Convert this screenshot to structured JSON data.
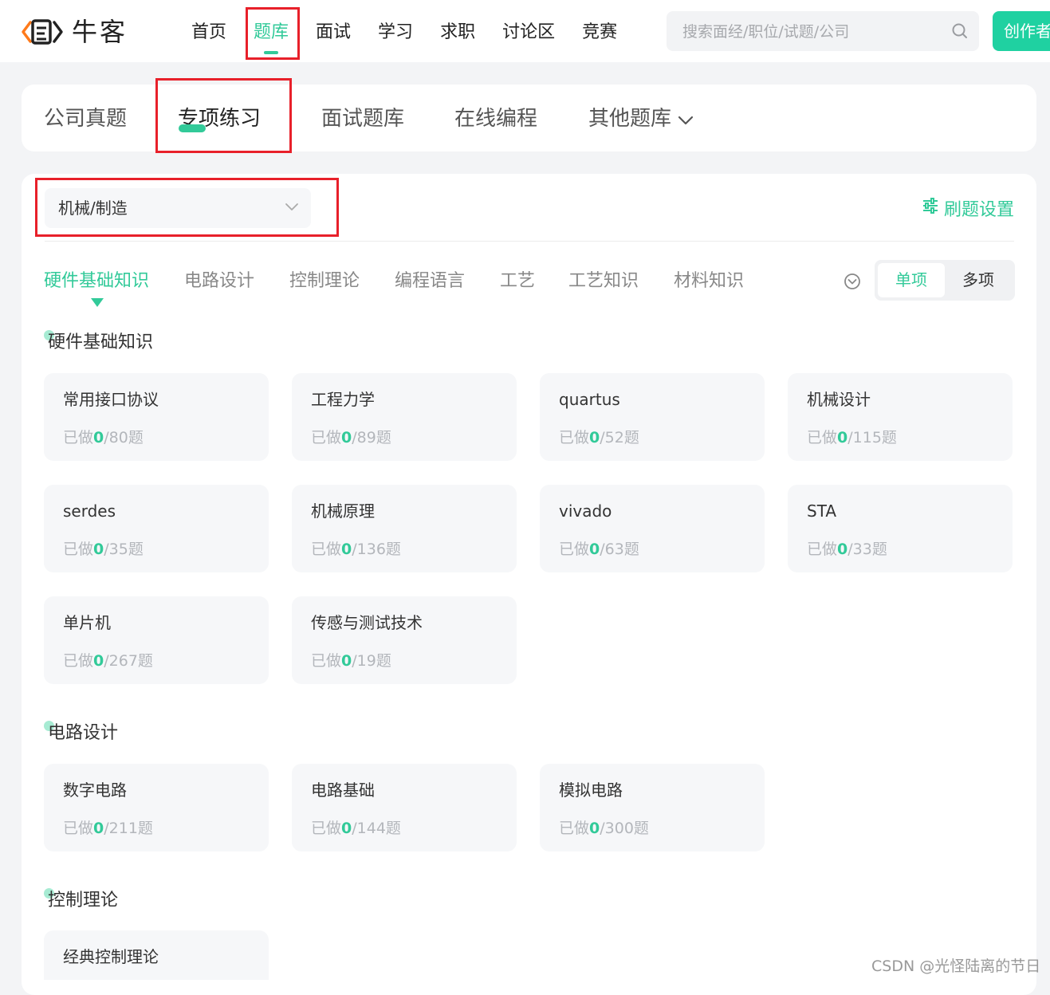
{
  "header": {
    "logo_text": "牛客",
    "nav": [
      "首页",
      "题库",
      "面试",
      "学习",
      "求职",
      "讨论区",
      "竞赛"
    ],
    "active_nav": 1,
    "search_placeholder": "搜索面经/职位/试题/公司",
    "create_button": "创作者"
  },
  "tabs": {
    "items": [
      "公司真题",
      "专项练习",
      "面试题库",
      "在线编程",
      "其他题库"
    ],
    "active": 1
  },
  "filter": {
    "selected_field": "机械/制造",
    "settings_label": "刷题设置",
    "categories": [
      "硬件基础知识",
      "电路设计",
      "控制理论",
      "编程语言",
      "工艺",
      "工艺知识",
      "材料知识"
    ],
    "active_category": 0,
    "mode_single": "单项",
    "mode_multi": "多项",
    "active_mode": "单项"
  },
  "progress_text": {
    "done_prefix": "已做",
    "suffix": "题"
  },
  "sections": [
    {
      "title": "硬件基础知识",
      "items": [
        {
          "name": "常用接口协议",
          "done": "0",
          "total": "/80"
        },
        {
          "name": "工程力学",
          "done": "0",
          "total": "/89"
        },
        {
          "name": "quartus",
          "done": "0",
          "total": "/52"
        },
        {
          "name": "机械设计",
          "done": "0",
          "total": "/115"
        },
        {
          "name": "serdes",
          "done": "0",
          "total": "/35"
        },
        {
          "name": "机械原理",
          "done": "0",
          "total": "/136"
        },
        {
          "name": "vivado",
          "done": "0",
          "total": "/63"
        },
        {
          "name": "STA",
          "done": "0",
          "total": "/33"
        },
        {
          "name": "单片机",
          "done": "0",
          "total": "/267"
        },
        {
          "name": "传感与测试技术",
          "done": "0",
          "total": "/19"
        }
      ]
    },
    {
      "title": "电路设计",
      "items": [
        {
          "name": "数字电路",
          "done": "0",
          "total": "/211"
        },
        {
          "name": "电路基础",
          "done": "0",
          "total": "/144"
        },
        {
          "name": "模拟电路",
          "done": "0",
          "total": "/300"
        }
      ]
    },
    {
      "title": "控制理论",
      "items": [
        {
          "name": "经典控制理论"
        }
      ]
    }
  ],
  "watermark": "CSDN @光怪陆离的节日",
  "colors": {
    "accent": "#32ca99",
    "highlight_box": "#e8202a",
    "create_button": "#1fd1a1"
  },
  "icons": [
    "logo-icon",
    "search-icon",
    "chevron-down-icon",
    "sliders-icon",
    "expand-circle-icon"
  ]
}
